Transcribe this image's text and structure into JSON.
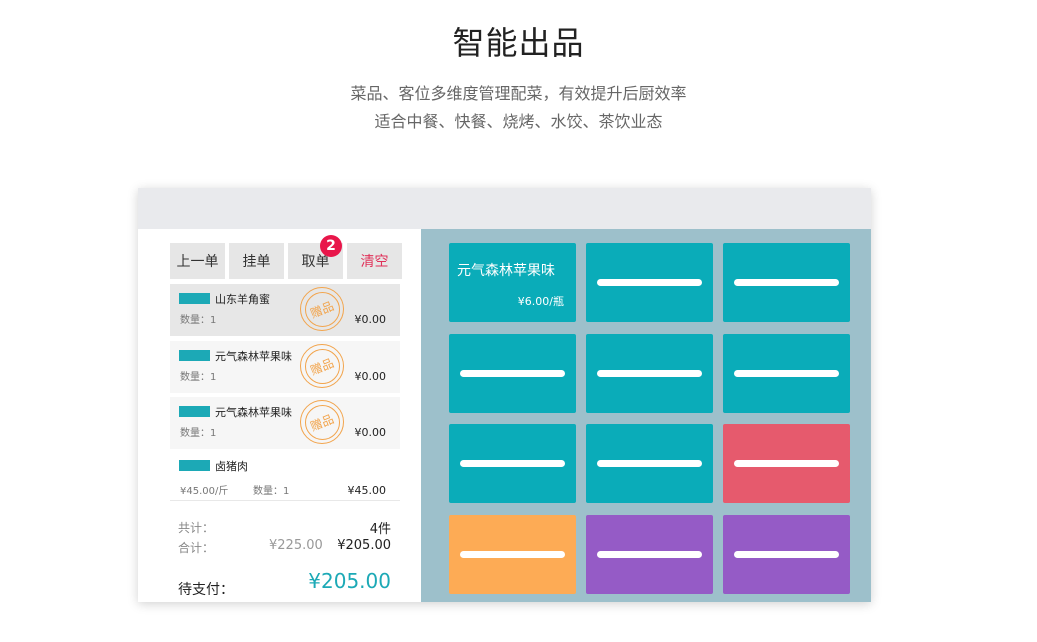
{
  "hero": {
    "title": "智能出品",
    "line1": "菜品、客位多维度管理配菜，有效提升后厨效率",
    "line2": "适合中餐、快餐、烧烤、水饺、茶饮业态"
  },
  "toolbar": {
    "prev_label": "上一单",
    "hold_label": "挂单",
    "retrieve_label": "取单",
    "retrieve_badge": "2",
    "clear_label": "清空"
  },
  "order_items": [
    {
      "name": "山东羊角蜜",
      "qty": "数量：1",
      "price": "¥0.00",
      "gift": "赠品"
    },
    {
      "name": "元气森林苹果味",
      "qty": "数量：1",
      "price": "¥0.00",
      "gift": "赠品"
    },
    {
      "name": "元气森林苹果味",
      "qty": "数量：1",
      "price": "¥0.00",
      "gift": "赠品"
    },
    {
      "name": "卤猪肉",
      "unit_price": "¥45.00/斤",
      "qty": "数量：1",
      "price": "¥45.00"
    }
  ],
  "summary": {
    "count_label": "共计：",
    "count_value": "4件",
    "total_label": "合计：",
    "original_total": "¥225.00",
    "total_value": "¥205.00",
    "due_label": "待支付：",
    "due_value": "¥205.00"
  },
  "menu_tiles": [
    {
      "name": "元气森林苹果味",
      "price": "¥6.00/瓶",
      "color": "#0aacb9"
    },
    {
      "color": "#0aacb9"
    },
    {
      "color": "#0aacb9"
    },
    {
      "color": "#0aacb9"
    },
    {
      "color": "#0aacb9"
    },
    {
      "color": "#0aacb9"
    },
    {
      "color": "#0aacb9"
    },
    {
      "color": "#0aacb9"
    },
    {
      "color": "#e65a6d"
    },
    {
      "color": "#fdab55"
    },
    {
      "color": "#955bc6"
    },
    {
      "color": "#955bc6"
    }
  ]
}
